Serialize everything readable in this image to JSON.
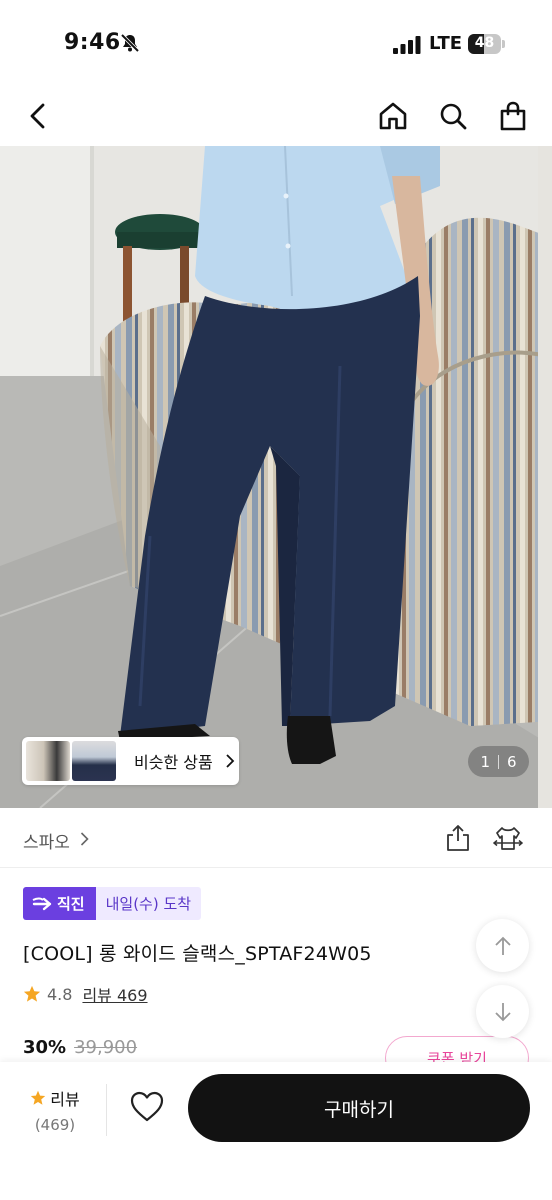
{
  "status_bar": {
    "time": "9:46",
    "network": "LTE",
    "battery_percent": 48,
    "battery_text": "48"
  },
  "nav": {
    "back_icon": "chevron-left-icon",
    "home_icon": "home-icon",
    "search_icon": "search-icon",
    "cart_icon": "shopping-bag-icon"
  },
  "gallery": {
    "similar_label": "비슷한 상품",
    "current_page": "1",
    "total_pages": "6"
  },
  "brand": {
    "name": "스파오"
  },
  "badges": {
    "direct": "직진",
    "delivery": "내일(수) 도착"
  },
  "product": {
    "title": "[COOL] 롱 와이드 슬랙스_SPTAF24W05",
    "rating": "4.8",
    "review_link": "리뷰 469",
    "discount": "30%",
    "original_price": "39,900",
    "coupon_label": "쿠폰 받기"
  },
  "bottom_bar": {
    "review_label": "리뷰",
    "review_count": "(469)",
    "buy_label": "구매하기"
  },
  "colors": {
    "accent_purple": "#6b3fe0",
    "delivery_bg": "#efeaff",
    "coupon_pink": "#e8459b",
    "star": "#f5a623",
    "buy_button": "#121212"
  }
}
